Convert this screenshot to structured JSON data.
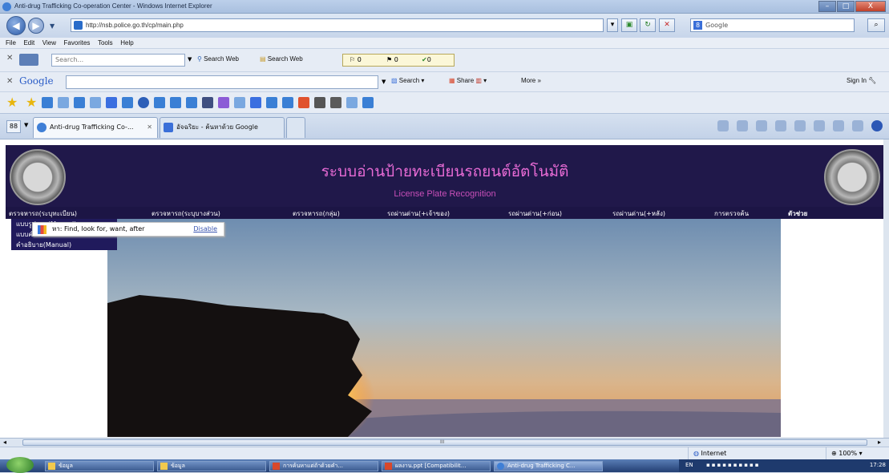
{
  "window": {
    "title": "Anti-drug Trafficking Co-operation Center - Windows Internet Explorer",
    "buttons": [
      "–",
      "□",
      "X"
    ]
  },
  "address": {
    "url": "http://nsb.police.go.th/cp/main.php",
    "search_placeholder": "Google"
  },
  "menubar": {
    "items": [
      "File",
      "Edit",
      "View",
      "Favorites",
      "Tools",
      "Help"
    ]
  },
  "toolbar1": {
    "search_placeholder": "Search...",
    "search_web_1": "Search Web",
    "search_web_2": "Search Web",
    "count_a": "0",
    "count_b": "0",
    "count_c": "0"
  },
  "toolbar2": {
    "logo": "Google",
    "search": "Search",
    "share": "Share",
    "more": "More »",
    "sign_in": "Sign In"
  },
  "tabs": [
    {
      "label": "Anti-drug Trafficking Co-...",
      "active": true
    },
    {
      "label": "อัจฉริยะ - ค้นหาด้วย Google",
      "active": false
    }
  ],
  "tab_dropdown": "88",
  "page": {
    "banner_title": "ระบบอ่านป้ายทะเบียนรถยนต์อัตโนมัติ",
    "banner_subtitle": "License Plate Recognition",
    "nav": [
      "ตรวจหารถ(ระบุทะเบียน)",
      "ตรวจหารถ(ระบุบางส่วน)",
      "ตรวจหารถ(กลุ่ม)",
      "รถผ่านด่าน(+เจ้าของ)",
      "รถผ่านด่าน(+ก่อน)",
      "รถผ่านด่าน(+หลัง)",
      "การตรวจค้น",
      "ตัวช่วย"
    ],
    "dropdown_items": [
      "แบบรูปแบบ(Manual)",
      "แบบคำสั่ง",
      "คำอธิบาย(Manual)"
    ],
    "tooltip_text": "หา: Find, look for, want, after",
    "tooltip_action": "Disable"
  },
  "scrollbar": {
    "middle_mark": "III"
  },
  "status": {
    "zone": "Internet",
    "zoom": "100%"
  },
  "taskbar": {
    "tasks": [
      "ข้อมูล",
      "ข้อมูล",
      "การค้นหาแต่ถ้าด้วยคำ...",
      "ผลงาน.ppt [Compatibilit...",
      "Anti-drug Trafficking C..."
    ],
    "lang": "EN",
    "clock": "17:28"
  }
}
